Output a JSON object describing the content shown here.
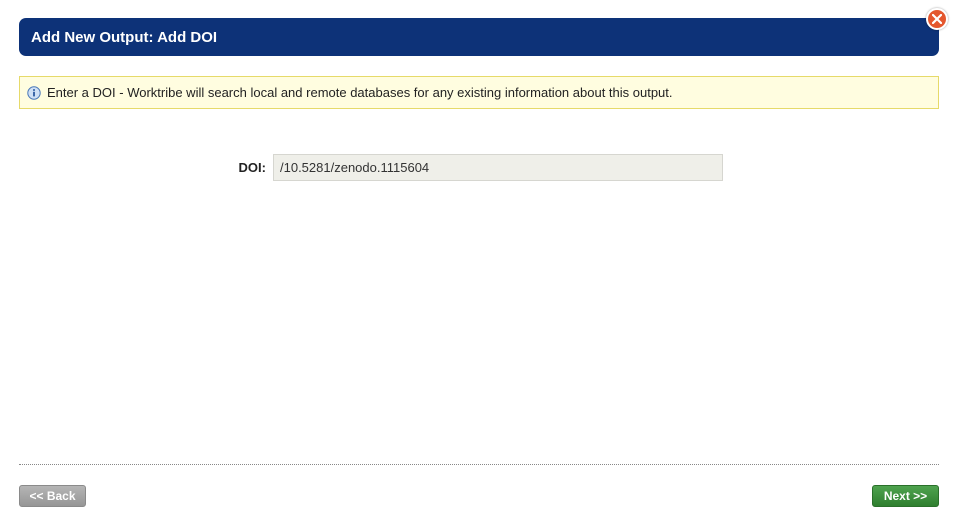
{
  "header": {
    "title": "Add New Output: Add DOI"
  },
  "info": {
    "icon": "info-icon",
    "message": "Enter a DOI - Worktribe will search local and remote databases for any existing information about this output."
  },
  "form": {
    "doi_label": "DOI:",
    "doi_value": "/10.5281/zenodo.1115604"
  },
  "footer": {
    "back_label": "<< Back",
    "next_label": "Next >>"
  },
  "colors": {
    "title_bar": "#0d3278",
    "info_background": "#fffde0",
    "info_border": "#e6da6a",
    "next_button": "#3a8f3a",
    "back_button": "#a5a5a5",
    "close_button": "#e4572e"
  }
}
